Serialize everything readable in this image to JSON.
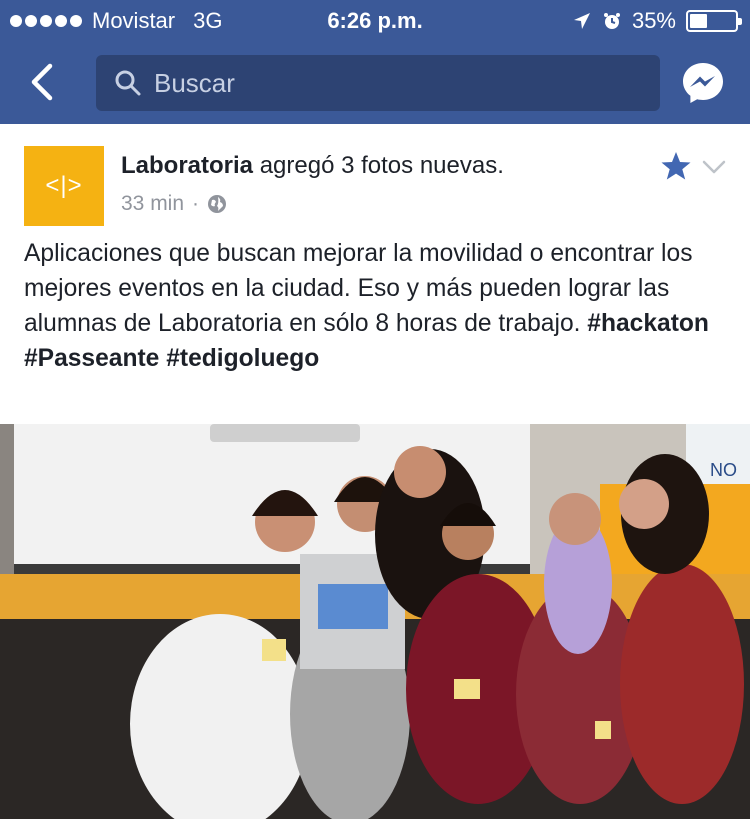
{
  "status_bar": {
    "carrier": "Movistar",
    "network": "3G",
    "time": "6:26 p.m.",
    "battery": "35%"
  },
  "nav": {
    "search_placeholder": "Buscar"
  },
  "post": {
    "page_name": "Laboratoria",
    "action_text": " agregó 3 fotos nuevas.",
    "logo_text": "<|>",
    "time_ago": "33 min",
    "separator": "·",
    "body_text": "Aplicaciones que buscan mejorar la movilidad o encontrar los mejores eventos en la ciudad. Eso y más pueden lograr las alumnas de Laboratoria en sólo 8 horas de trabajo. ",
    "hashtags": [
      "#hackaton",
      "#Passeante",
      "#tedigoluego"
    ],
    "photo_sign": "NO"
  },
  "colors": {
    "brand_blue": "#3b5998",
    "logo_yellow": "#f5b212",
    "star_blue": "#4267b2"
  }
}
